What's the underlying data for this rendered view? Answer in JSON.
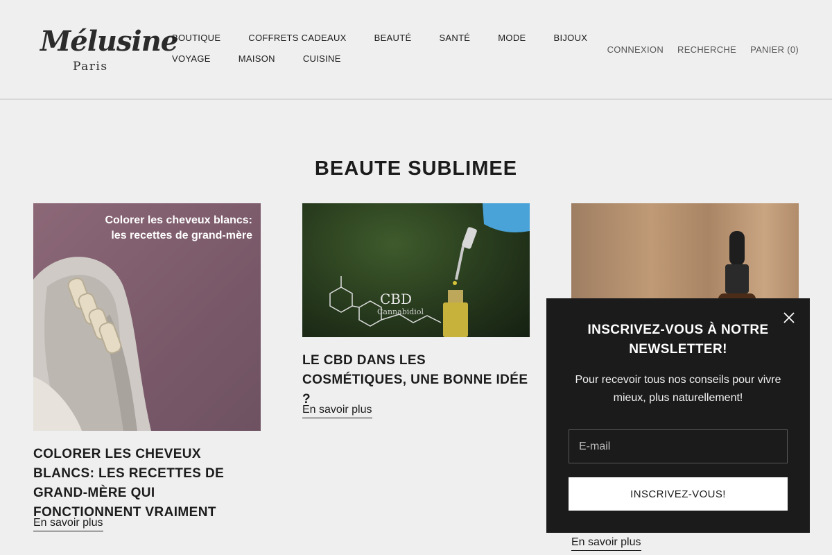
{
  "header": {
    "logo": {
      "script": "Mélusine",
      "sub": "Paris"
    },
    "nav_row1": [
      "BOUTIQUE",
      "COFFRETS CADEAUX",
      "BEAUTÉ",
      "SANTÉ",
      "MODE",
      "BIJOUX"
    ],
    "nav_row2": [
      "VOYAGE",
      "MAISON",
      "CUISINE"
    ],
    "secondary": {
      "login": "CONNEXION",
      "search": "RECHERCHE",
      "cart": "PANIER (0)"
    }
  },
  "page": {
    "title": "BEAUTE SUBLIMEE"
  },
  "articles": [
    {
      "title": "COLORER LES CHEVEUX BLANCS: LES RECETTES DE GRAND-MÈRE QUI FONCTIONNENT VRAIMENT",
      "image_text": [
        "Colorer les cheveux blancs:",
        "les recettes de grand-mère"
      ],
      "link": "En savoir plus"
    },
    {
      "title": "LE CBD DANS LES COSMÉTIQUES, UNE BONNE IDÉE ?",
      "image_text": [
        "CBD",
        "Cannabidiol"
      ],
      "link": "En savoir plus"
    },
    {
      "title": "",
      "link": "En savoir plus"
    }
  ],
  "newsletter": {
    "heading": "INSCRIVEZ-VOUS À NOTRE NEWSLETTER!",
    "description": "Pour recevoir tous nos conseils pour vivre mieux, plus naturellement!",
    "email_placeholder": "E-mail",
    "submit_label": "INSCRIVEZ-VOUS!"
  },
  "colors": {
    "background": "#efefef",
    "text": "#1c1b1b",
    "popup": "#1c1b1b",
    "popup_button": "#ffffff"
  },
  "icons": {
    "close": "close-icon"
  }
}
